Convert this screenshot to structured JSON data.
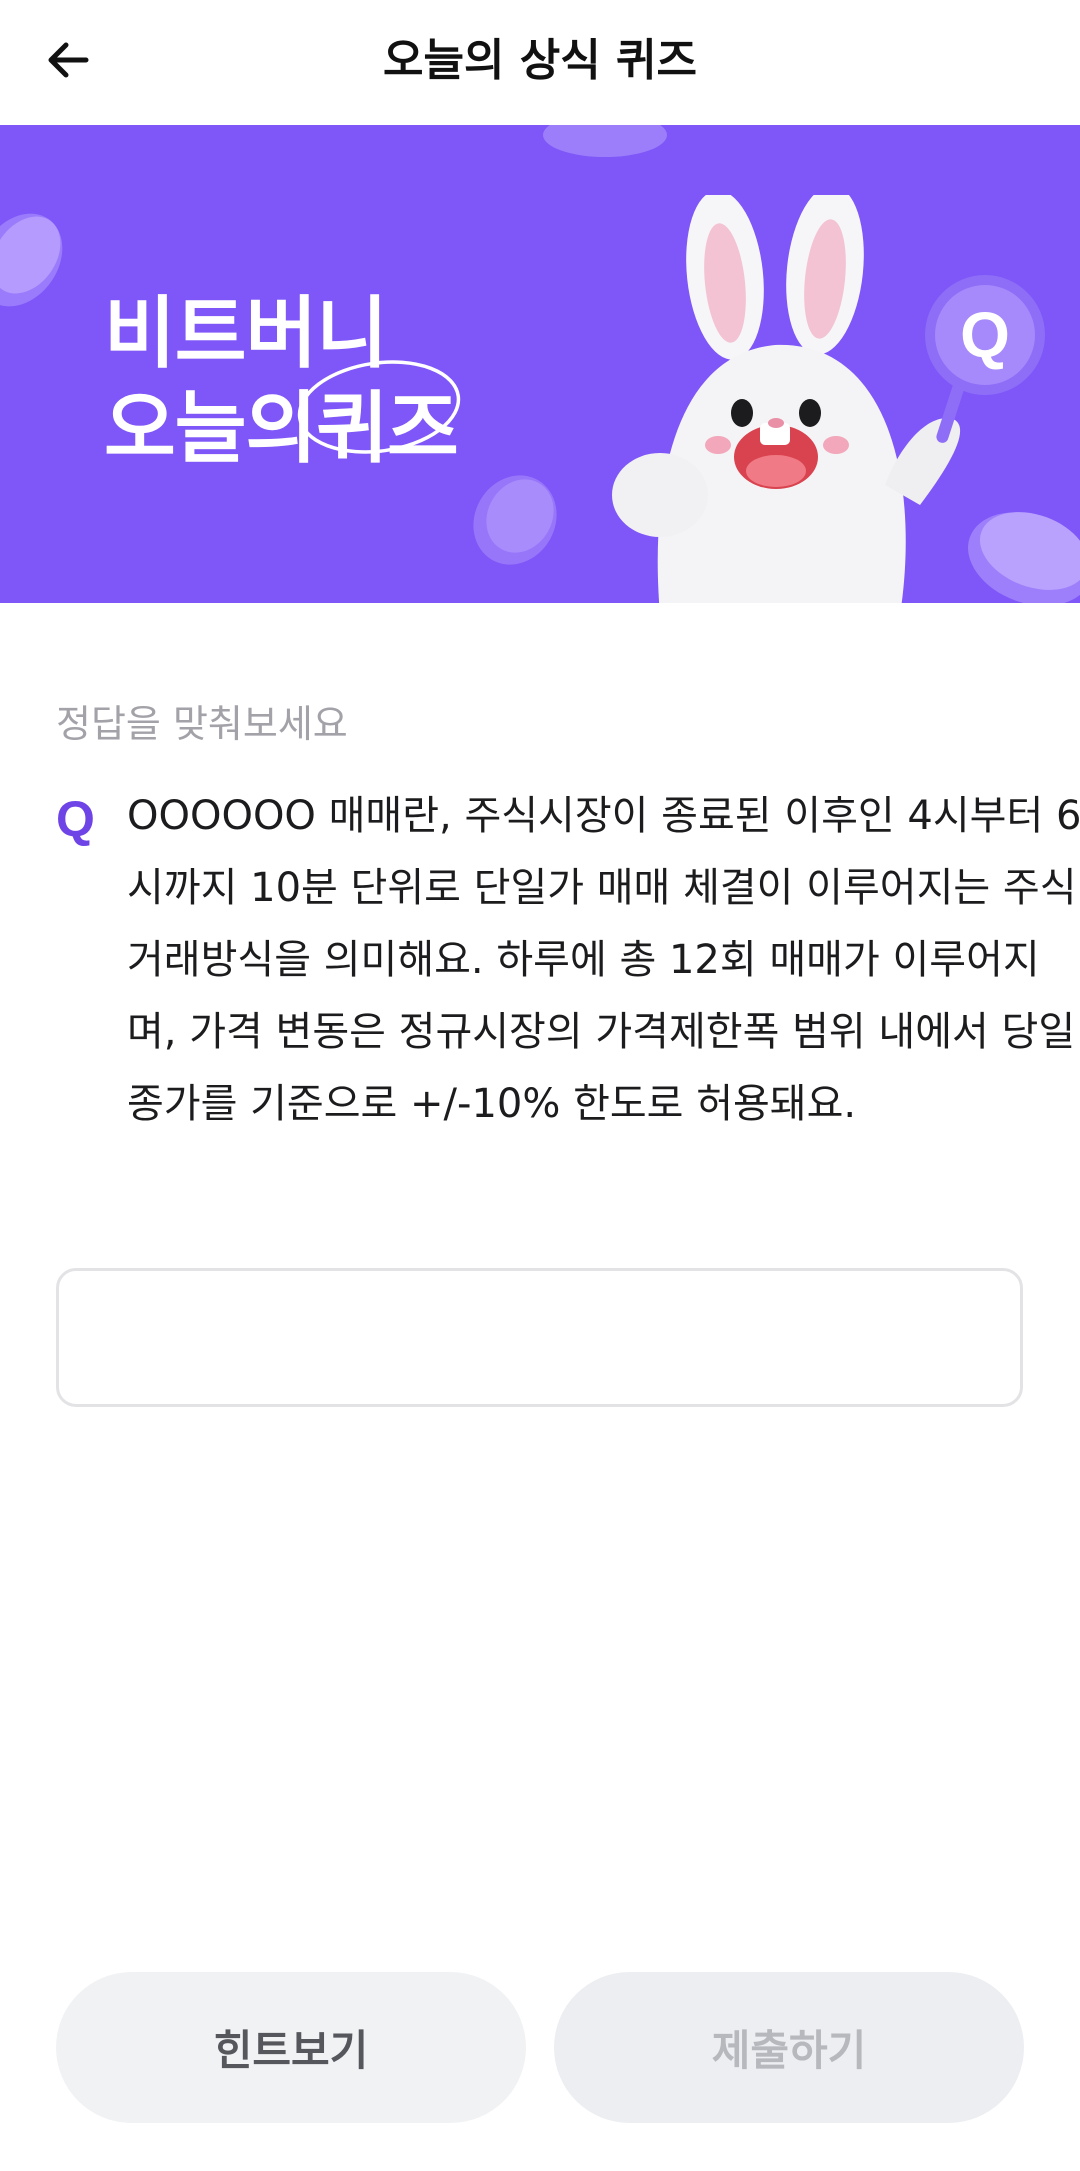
{
  "header": {
    "title": "오늘의 상식 퀴즈",
    "back_icon": "arrow-left-icon"
  },
  "banner": {
    "line1": "비트버니",
    "line2_prefix": "오늘의",
    "line2_highlight": "퀴즈",
    "background_color": "#7f56f8",
    "character": "rabbit-mascot",
    "badge_letter": "Q"
  },
  "quiz": {
    "prompt": "정답을 맞춰보세요",
    "q_marker": "Q",
    "question": "OOOOOO 매매란, 주식시장이 종료된 이후인 4시부터 6시까지 10분 단위로 단일가 매매 체결이 이루어지는 주식거래방식을 의미해요. 하루에 총 12회 매매가 이루어지며, 가격 변동은 정규시장의 가격제한폭 범위 내에서 당일 종가를 기준으로 +/-10% 한도로 허용돼요.",
    "answer_value": "",
    "accent_color": "#6e44e6"
  },
  "actions": {
    "hint_label": "힌트보기",
    "submit_label": "제출하기"
  }
}
